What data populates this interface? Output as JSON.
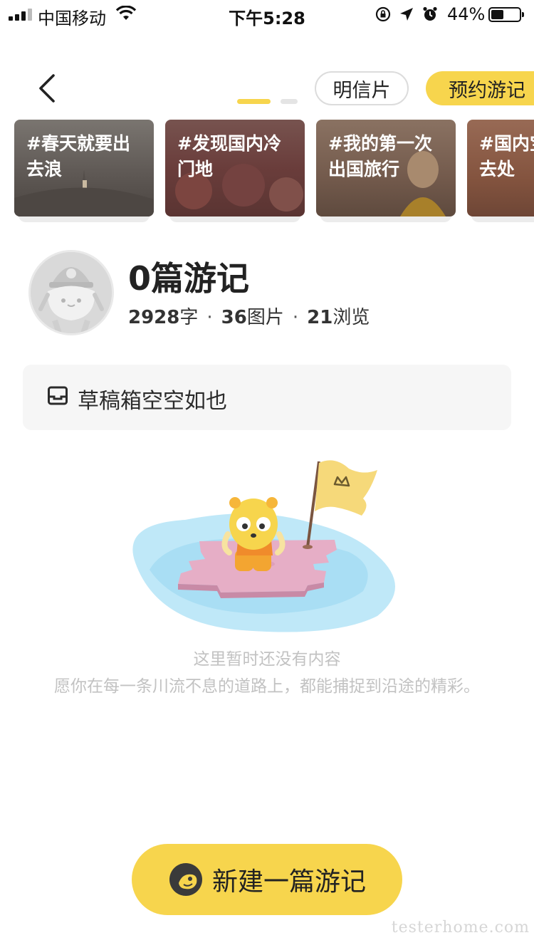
{
  "status_bar": {
    "carrier": "中国移动",
    "time": "下午5:28",
    "battery_percent_text": "44%",
    "battery_level": 0.44,
    "icons": [
      "signal-icon",
      "wifi-icon",
      "rotation-lock-icon",
      "location-arrow-icon",
      "alarm-icon",
      "battery-icon"
    ]
  },
  "header": {
    "back_icon": "chevron-left-icon",
    "pager": {
      "total": 2,
      "active_index": 0
    },
    "tabs": [
      {
        "label": "明信片",
        "active": false
      },
      {
        "label": "预约游记",
        "active": true
      }
    ]
  },
  "topics": [
    {
      "line1": "#春天就要出",
      "line2": "去浪",
      "color": "#6b6460"
    },
    {
      "line1": "#发现国内冷",
      "line2": "门地",
      "color": "#6e4a48"
    },
    {
      "line1": "#我的第一次",
      "line2": "出国旅行",
      "color": "#7a6153"
    },
    {
      "line1": "#国内宝",
      "line2": "去处",
      "color": "#8a5a4a"
    }
  ],
  "profile": {
    "title": "0篇游记",
    "stats": [
      {
        "value": "2928",
        "unit": "字"
      },
      {
        "value": "36",
        "unit": "图片"
      },
      {
        "value": "21",
        "unit": "浏览"
      }
    ],
    "separator": "·"
  },
  "drafts": {
    "icon": "inbox-icon",
    "text": "草稿箱空空如也"
  },
  "empty_state": {
    "title": "这里暂时还没有内容",
    "subtitle": "愿你在每一条川流不息的道路上，都能捕捉到沿途的精彩。"
  },
  "new_button": {
    "label": "新建一篇游记",
    "icon": "mascot-logo-icon"
  },
  "watermark": "testerhome.com",
  "colors": {
    "accent": "#f7d54d",
    "muted_text": "#c2c2c2",
    "box_bg": "#f6f6f6"
  }
}
